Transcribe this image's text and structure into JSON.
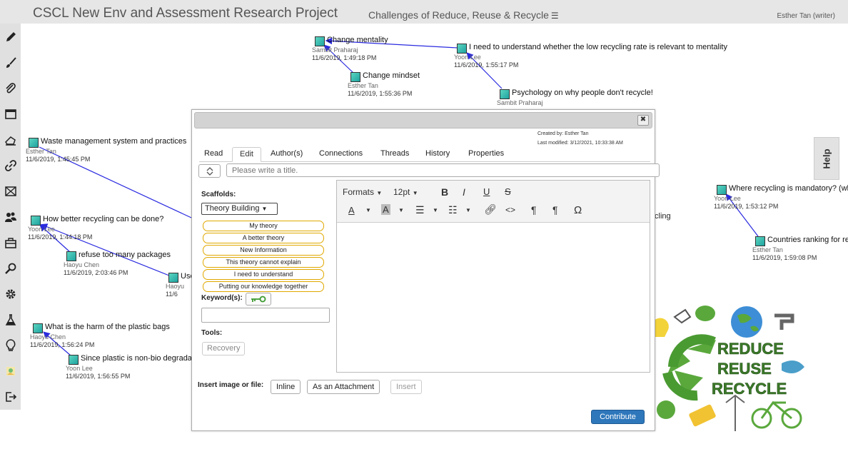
{
  "app_title": "CSCL New Env and Assessment Research Project",
  "view_title": "Challenges of Reduce, Reuse & Recycle",
  "user": "Esther Tan (writer)",
  "help_label": "Help",
  "toolbar_icons": [
    "pencil-icon",
    "brush-icon",
    "paperclip-icon",
    "window-icon",
    "hand-pointer-icon",
    "link-icon",
    "resize-icon",
    "people-icon",
    "briefcase-icon",
    "magnifier-icon",
    "gear-icon",
    "flask-icon",
    "lightbulb-icon",
    "image-icon",
    "logout-icon"
  ],
  "notes": [
    {
      "title": "Change mentality",
      "author": "Sambit Praharaj",
      "date": "11/6/2019, 1:49:18 PM"
    },
    {
      "title": "I need to understand whether the low recycling rate is relevant to mentality",
      "author": "Yoon Lee",
      "date": "11/6/2019, 1:55:17 PM"
    },
    {
      "title": "Change mindset",
      "author": "Esther Tan",
      "date": "11/6/2019, 1:55:36 PM"
    },
    {
      "title": "Psychology on why people don't recycle!",
      "author": "Sambit Praharaj",
      "date": ""
    },
    {
      "title": "Waste management system and practices",
      "author": "Esther Tan",
      "date": "11/6/2019, 1:45:45 PM"
    },
    {
      "title": "How better recycling can be done?",
      "author": "Yoon Lee",
      "date": "11/6/2019, 1:44:18 PM"
    },
    {
      "title": "refuse too many packages",
      "author": "Haoyu Chen",
      "date": "11/6/2019, 2:03:46 PM"
    },
    {
      "title": "Use",
      "author": "Haoyu",
      "date": "11/6"
    },
    {
      "title": "What is the harm of the plastic bags",
      "author": "Haoyu Chen",
      "date": "11/6/2019, 1:56:24 PM"
    },
    {
      "title": "Since plastic is non-bio degrada",
      "author": "Yoon Lee",
      "date": "11/6/2019, 1:56:55 PM"
    },
    {
      "title": "Where recycling is mandatory? (wh",
      "author": "Yoon Lee",
      "date": "11/6/2019, 1:53:12 PM"
    },
    {
      "title": "Countries ranking for re",
      "author": "Esther Tan",
      "date": "11/6/2019, 1:59:08 PM"
    }
  ],
  "partial_text": "cling",
  "dialog": {
    "created_by": "Created by: Esther Tan",
    "last_modified": "Last modified: 3/12/2021, 10:33:38 AM",
    "tabs": [
      "Read",
      "Edit",
      "Author(s)",
      "Connections",
      "Threads",
      "History",
      "Properties"
    ],
    "active_tab": "Edit",
    "title_placeholder": "Please write a title.",
    "scaffolds_label": "Scaffolds:",
    "scaffold_select": "Theory Building",
    "scaffolds": [
      "My theory",
      "A better theory",
      "New Information",
      "This theory cannot explain",
      "I need to understand",
      "Putting our knowledge together"
    ],
    "keywords_label": "Keyword(s):",
    "tools_label": "Tools:",
    "recovery_label": "Recovery",
    "editor": {
      "formats": "Formats",
      "font_size": "12pt",
      "bold": "B",
      "italic": "I",
      "underline": "U",
      "strike": "S",
      "omega": "Ω"
    },
    "insert_label": "Insert image or file:",
    "inline_label": "Inline",
    "attachment_label": "As an Attachment",
    "insert_button": "Insert",
    "contribute_label": "Contribute"
  },
  "art_text": [
    "REDUCE",
    "REUSE",
    "RECYCLE"
  ],
  "colors": {
    "link": "#2a2ae0",
    "accent": "#2e77bb",
    "scaffold_border": "#e0a800",
    "recycle_green": "#5aa83c"
  }
}
